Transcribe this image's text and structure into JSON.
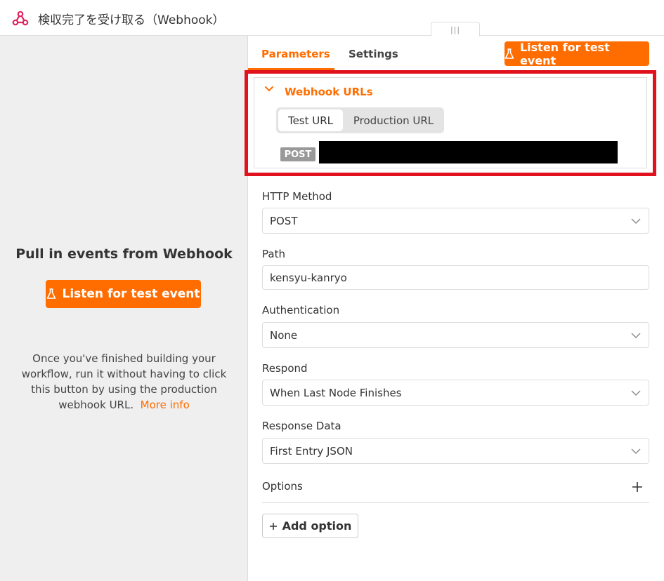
{
  "window": {
    "title": "検収完了を受け取る（Webhook）"
  },
  "colors": {
    "accent": "#ff6d00",
    "highlight": "#e0121e"
  },
  "left_panel": {
    "heading": "Pull in events from Webhook",
    "listen_button": "Listen for test event",
    "description": "Once you've finished building your workflow, run it without having to click this button by using the production webhook URL.",
    "more_info": "More info"
  },
  "tabs": [
    {
      "label": "Parameters",
      "active": true
    },
    {
      "label": "Settings",
      "active": false
    }
  ],
  "top_button": "Listen for test event",
  "webhook_urls": {
    "title": "Webhook URLs",
    "segments": [
      "Test URL",
      "Production URL"
    ],
    "selected": "Test URL",
    "method_badge": "POST"
  },
  "fields": {
    "http_method": {
      "label": "HTTP Method",
      "value": "POST"
    },
    "path": {
      "label": "Path",
      "value": "kensyu-kanryo"
    },
    "authentication": {
      "label": "Authentication",
      "value": "None"
    },
    "respond": {
      "label": "Respond",
      "value": "When Last Node Finishes"
    },
    "response_data": {
      "label": "Response Data",
      "value": "First Entry JSON"
    }
  },
  "options": {
    "label": "Options",
    "add_label": "Add option"
  },
  "icons": {
    "title": "webhook-icon",
    "flask": "flask-icon",
    "chevron": "chevron-down-icon",
    "plus": "plus-icon"
  }
}
